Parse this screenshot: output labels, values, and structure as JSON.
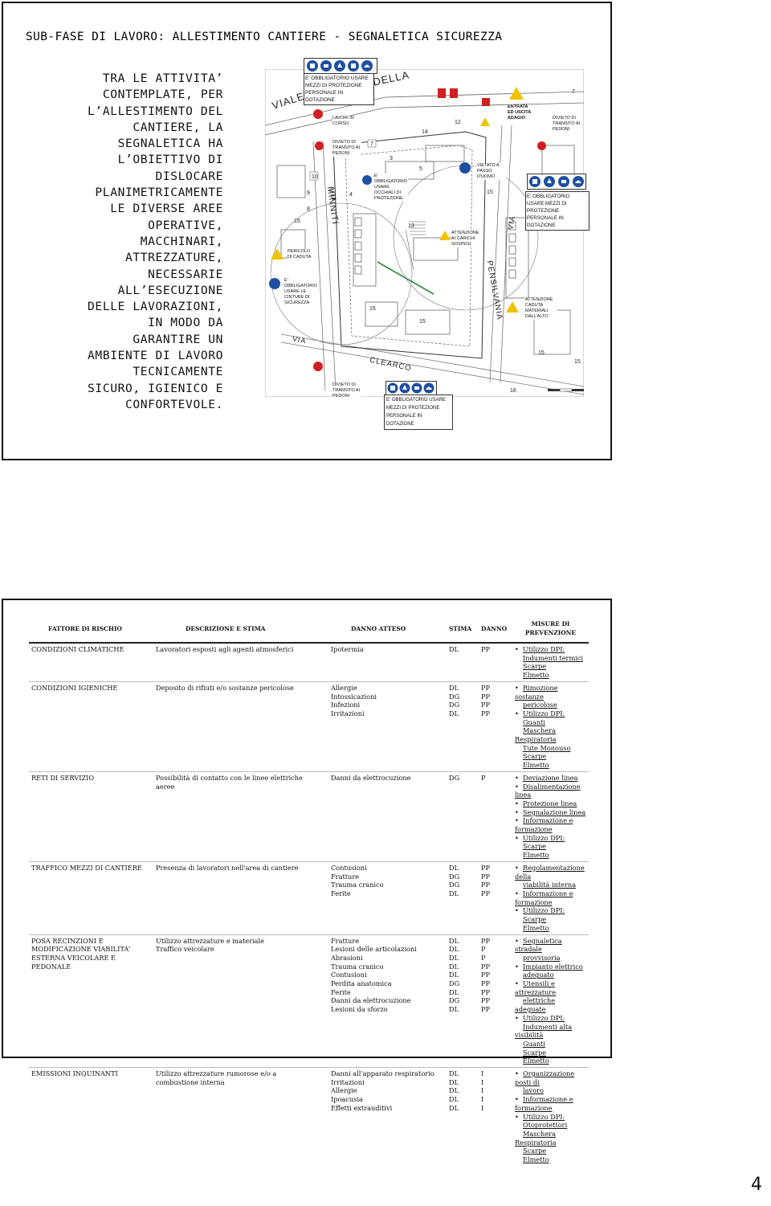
{
  "slide1": {
    "title": "SUB-FASE DI LAVORO: ALLESTIMENTO CANTIERE - SEGNALETICA SICUREZZA",
    "intro_lines": [
      "TRA LE ATTIVITA’",
      "CONTEMPLATE, PER",
      "L’ALLESTIMENTO DEL",
      "CANTIERE, LA",
      "SEGNALETICA HA",
      "L’OBIETTIVO DI",
      "DISLOCARE",
      "PLANIMETRICAMENTE",
      "LE DIVERSE AREE",
      "OPERATIVE,",
      "MACCHINARI,",
      "ATTREZZATURE,",
      "NECESSARIE",
      "ALL’ESECUZIONE",
      "DELLE LAVORAZIONI,",
      "IN MODO DA",
      "GARANTIRE UN",
      "AMBIENTE DI LAVORO",
      "TECNICAMENTE",
      "SICURO, IGIENICO E",
      "CONFORTEVOLE."
    ],
    "plan": {
      "streets": [
        "VIALE",
        "DELLA",
        "VIA",
        "MINNITI",
        "VIA",
        "CLEARCO",
        "VIA",
        "PENSILVANIA"
      ],
      "signs": {
        "obbligo_top": "E' OBBLIGATORIO USARE MEZZI DI PROTEZIONE PERSONALE IN DOTAZIONE",
        "obbligo_right": "E' OBBLIGATORIO USARE MEZZI DI PROTEZIONE PERSONALE IN DOTAZIONE",
        "obbligo_bottom": "E' OBBLIGATORIO USARE MEZZI DI PROTEZIONE PERSONALE IN DOTAZIONE",
        "lavori_1": "LAVORI IN CORSO",
        "divieto_1": "DIVIETO DI TRANSITO AI PEDONI",
        "divieto_2": "DIVIETO DI TRANSITO AI PEDONI",
        "divieto_3": "DIVIETO DI TRANSITO AI PEDONI",
        "occhiali": "E' OBBLIGATORIO USARE OCCHIALI DI PROTEZIONE",
        "vietato": "VIETATO A PASSO D'UOMO",
        "pericolo": "PERICOLO DI CADUTA",
        "cinture": "E' OBBLIGATORIO USARE LE CINTURE DI SICUREZZA",
        "carichi": "ATTENZIONE AI CARICHI SOSPESI",
        "caduta_mat": "ATTENZIONE CADUTA MATERIALI DALL'ALTO",
        "entrata": "ENTRATA ED USCITA ADAGIO"
      },
      "numbers": [
        "10",
        "9",
        "8",
        "15",
        "7",
        "3",
        "5",
        "4",
        "13",
        "15",
        "15",
        "16",
        "15",
        "15",
        "14",
        "12"
      ]
    }
  },
  "slide2": {
    "headers": [
      "FATTORE DI RISCHIO",
      "DESCRIZIONE E STIMA",
      "DANNO ATTESO",
      "STIMA",
      "DANNO",
      "MISURE DI PREVENZIONE"
    ],
    "rows": [
      {
        "factor": "CONDIZIONI CLIMATICHE",
        "desc": [
          "Lavoratori esposti agli agenti atmosferici"
        ],
        "damage": [
          "Ipotermia"
        ],
        "stima": [
          "DL"
        ],
        "danno": [
          "PP"
        ],
        "measures": [
          {
            "bullet": true,
            "text": "Utilizzo DPI:"
          },
          {
            "bullet": false,
            "text": "Indumenti termici"
          },
          {
            "bullet": false,
            "text": "Scarpe"
          },
          {
            "bullet": false,
            "text": "Elmetto"
          }
        ]
      },
      {
        "factor": "CONDIZIONI IGIENICHE",
        "desc": [
          "Deposito di rifiuti e/o sostanze pericolose"
        ],
        "damage": [
          "Allergie",
          "Intossicazioni",
          "Infezioni",
          "Irritazioni"
        ],
        "stima": [
          "DL",
          "DG",
          "DG",
          "DL"
        ],
        "danno": [
          "PP",
          "PP",
          "PP",
          "PP"
        ],
        "measures": [
          {
            "bullet": true,
            "text": "Rimozione sostanze"
          },
          {
            "bullet": false,
            "text": "pericolose"
          },
          {
            "bullet": true,
            "text": "Utilizzo DPI:"
          },
          {
            "bullet": false,
            "text": "Guanti"
          },
          {
            "bullet": false,
            "text": "Maschera Respiratoria"
          },
          {
            "bullet": false,
            "text": "Tute Monouso"
          },
          {
            "bullet": false,
            "text": "Scarpe"
          },
          {
            "bullet": false,
            "text": "Elmetto"
          }
        ]
      },
      {
        "factor": "RETI DI SERVIZIO",
        "desc": [
          "Possibilità di contatto con le linee elettriche",
          "aeree"
        ],
        "damage": [
          "Danni da elettrocuzione"
        ],
        "stima": [
          "DG"
        ],
        "danno": [
          "P"
        ],
        "measures": [
          {
            "bullet": true,
            "text": "Deviazione linea"
          },
          {
            "bullet": true,
            "text": "Disalimentazione linea"
          },
          {
            "bullet": true,
            "text": "Protezione linea"
          },
          {
            "bullet": true,
            "text": "Segnalazione linea"
          },
          {
            "bullet": true,
            "text": "Informazione e formazione"
          },
          {
            "bullet": true,
            "text": "Utilizzo DPI:"
          },
          {
            "bullet": false,
            "text": "Scarpe"
          },
          {
            "bullet": false,
            "text": "Elmetto"
          }
        ]
      },
      {
        "factor": "TRAFFICO MEZZI DI CANTIERE",
        "desc": [
          "Presenza di lavoratori nell'area di cantiere"
        ],
        "damage": [
          "Contusioni",
          "Fratture",
          "Trauma cranico",
          "Ferite"
        ],
        "stima": [
          "DL",
          "DG",
          "DG",
          "DL"
        ],
        "danno": [
          "PP",
          "PP",
          "PP",
          "PP"
        ],
        "measures": [
          {
            "bullet": true,
            "text": "Regolamentazione della"
          },
          {
            "bullet": false,
            "text": "viabilità interna"
          },
          {
            "bullet": true,
            "text": "Informazione e formazione"
          },
          {
            "bullet": true,
            "text": "Utilizzo DPI:"
          },
          {
            "bullet": false,
            "text": "Scarpe"
          },
          {
            "bullet": false,
            "text": "Elmetto"
          }
        ]
      },
      {
        "factor": "POSA RECINZIONI E MODIFICAZIONE VIABILITA' ESTERNA VEICOLARE E PEDONALE",
        "desc": [
          "Utilizzo attrezzature e materiale",
          "Traffico veicolare"
        ],
        "damage": [
          "Fratture",
          "Lesioni delle articolazioni",
          "Abrasioni",
          "Trauma cranico",
          "Contusioni",
          "Perdita anatomica",
          "Ferite",
          "Danni da elettrocuzione",
          "Lesioni da sforzo"
        ],
        "stima": [
          "DL",
          "DL",
          "DL",
          "DL",
          "DL",
          "DG",
          "DL",
          "DG",
          "DL"
        ],
        "danno": [
          "PP",
          "P",
          "P",
          "PP",
          "PP",
          "PP",
          "PP",
          "PP",
          "PP"
        ],
        "measures": [
          {
            "bullet": true,
            "text": "Segnaletica stradale"
          },
          {
            "bullet": false,
            "text": "provvisoria"
          },
          {
            "bullet": true,
            "text": "Impianto elettrico"
          },
          {
            "bullet": false,
            "text": "adeguato"
          },
          {
            "bullet": true,
            "text": "Utensili e attrezzature"
          },
          {
            "bullet": false,
            "text": "elettriche adeguate"
          },
          {
            "bullet": true,
            "text": "Utilizzo DPI:"
          },
          {
            "bullet": false,
            "text": "Indumenti alta visibilità"
          },
          {
            "bullet": false,
            "text": "Guanti"
          },
          {
            "bullet": false,
            "text": "Scarpe"
          },
          {
            "bullet": false,
            "text": "Elmetto"
          }
        ]
      },
      {
        "factor": "EMISSIONI INQUINANTI",
        "desc": [
          "Utilizzo attrezzature rumorose e/o a",
          "combustione interna"
        ],
        "damage": [
          "Danni all'apparato respiratorio",
          "Irritazioni",
          "Allergie",
          "Ipoacusia",
          "Effetti extrauditivi"
        ],
        "stima": [
          "DL",
          "DL",
          "DL",
          "DL",
          "DL"
        ],
        "danno": [
          "I",
          "I",
          "I",
          "I",
          "I"
        ],
        "measures": [
          {
            "bullet": true,
            "text": "Organizzazione posti di"
          },
          {
            "bullet": false,
            "text": "lavoro"
          },
          {
            "bullet": true,
            "text": "Informazione e formazione"
          },
          {
            "bullet": true,
            "text": "Utilizzo DPI:"
          },
          {
            "bullet": false,
            "text": "Otoprotettori"
          },
          {
            "bullet": false,
            "text": "Maschera Respiratoria"
          },
          {
            "bullet": false,
            "text": "Scarpe"
          },
          {
            "bullet": false,
            "text": "Elmetto"
          }
        ]
      }
    ]
  },
  "page_number": "4",
  "colors": {
    "sign_blue": "#1f4fa0",
    "sign_red": "#d02020",
    "sign_yellow": "#f2c200",
    "plan_line": "#555555",
    "route_green": "#2e8b3a"
  }
}
